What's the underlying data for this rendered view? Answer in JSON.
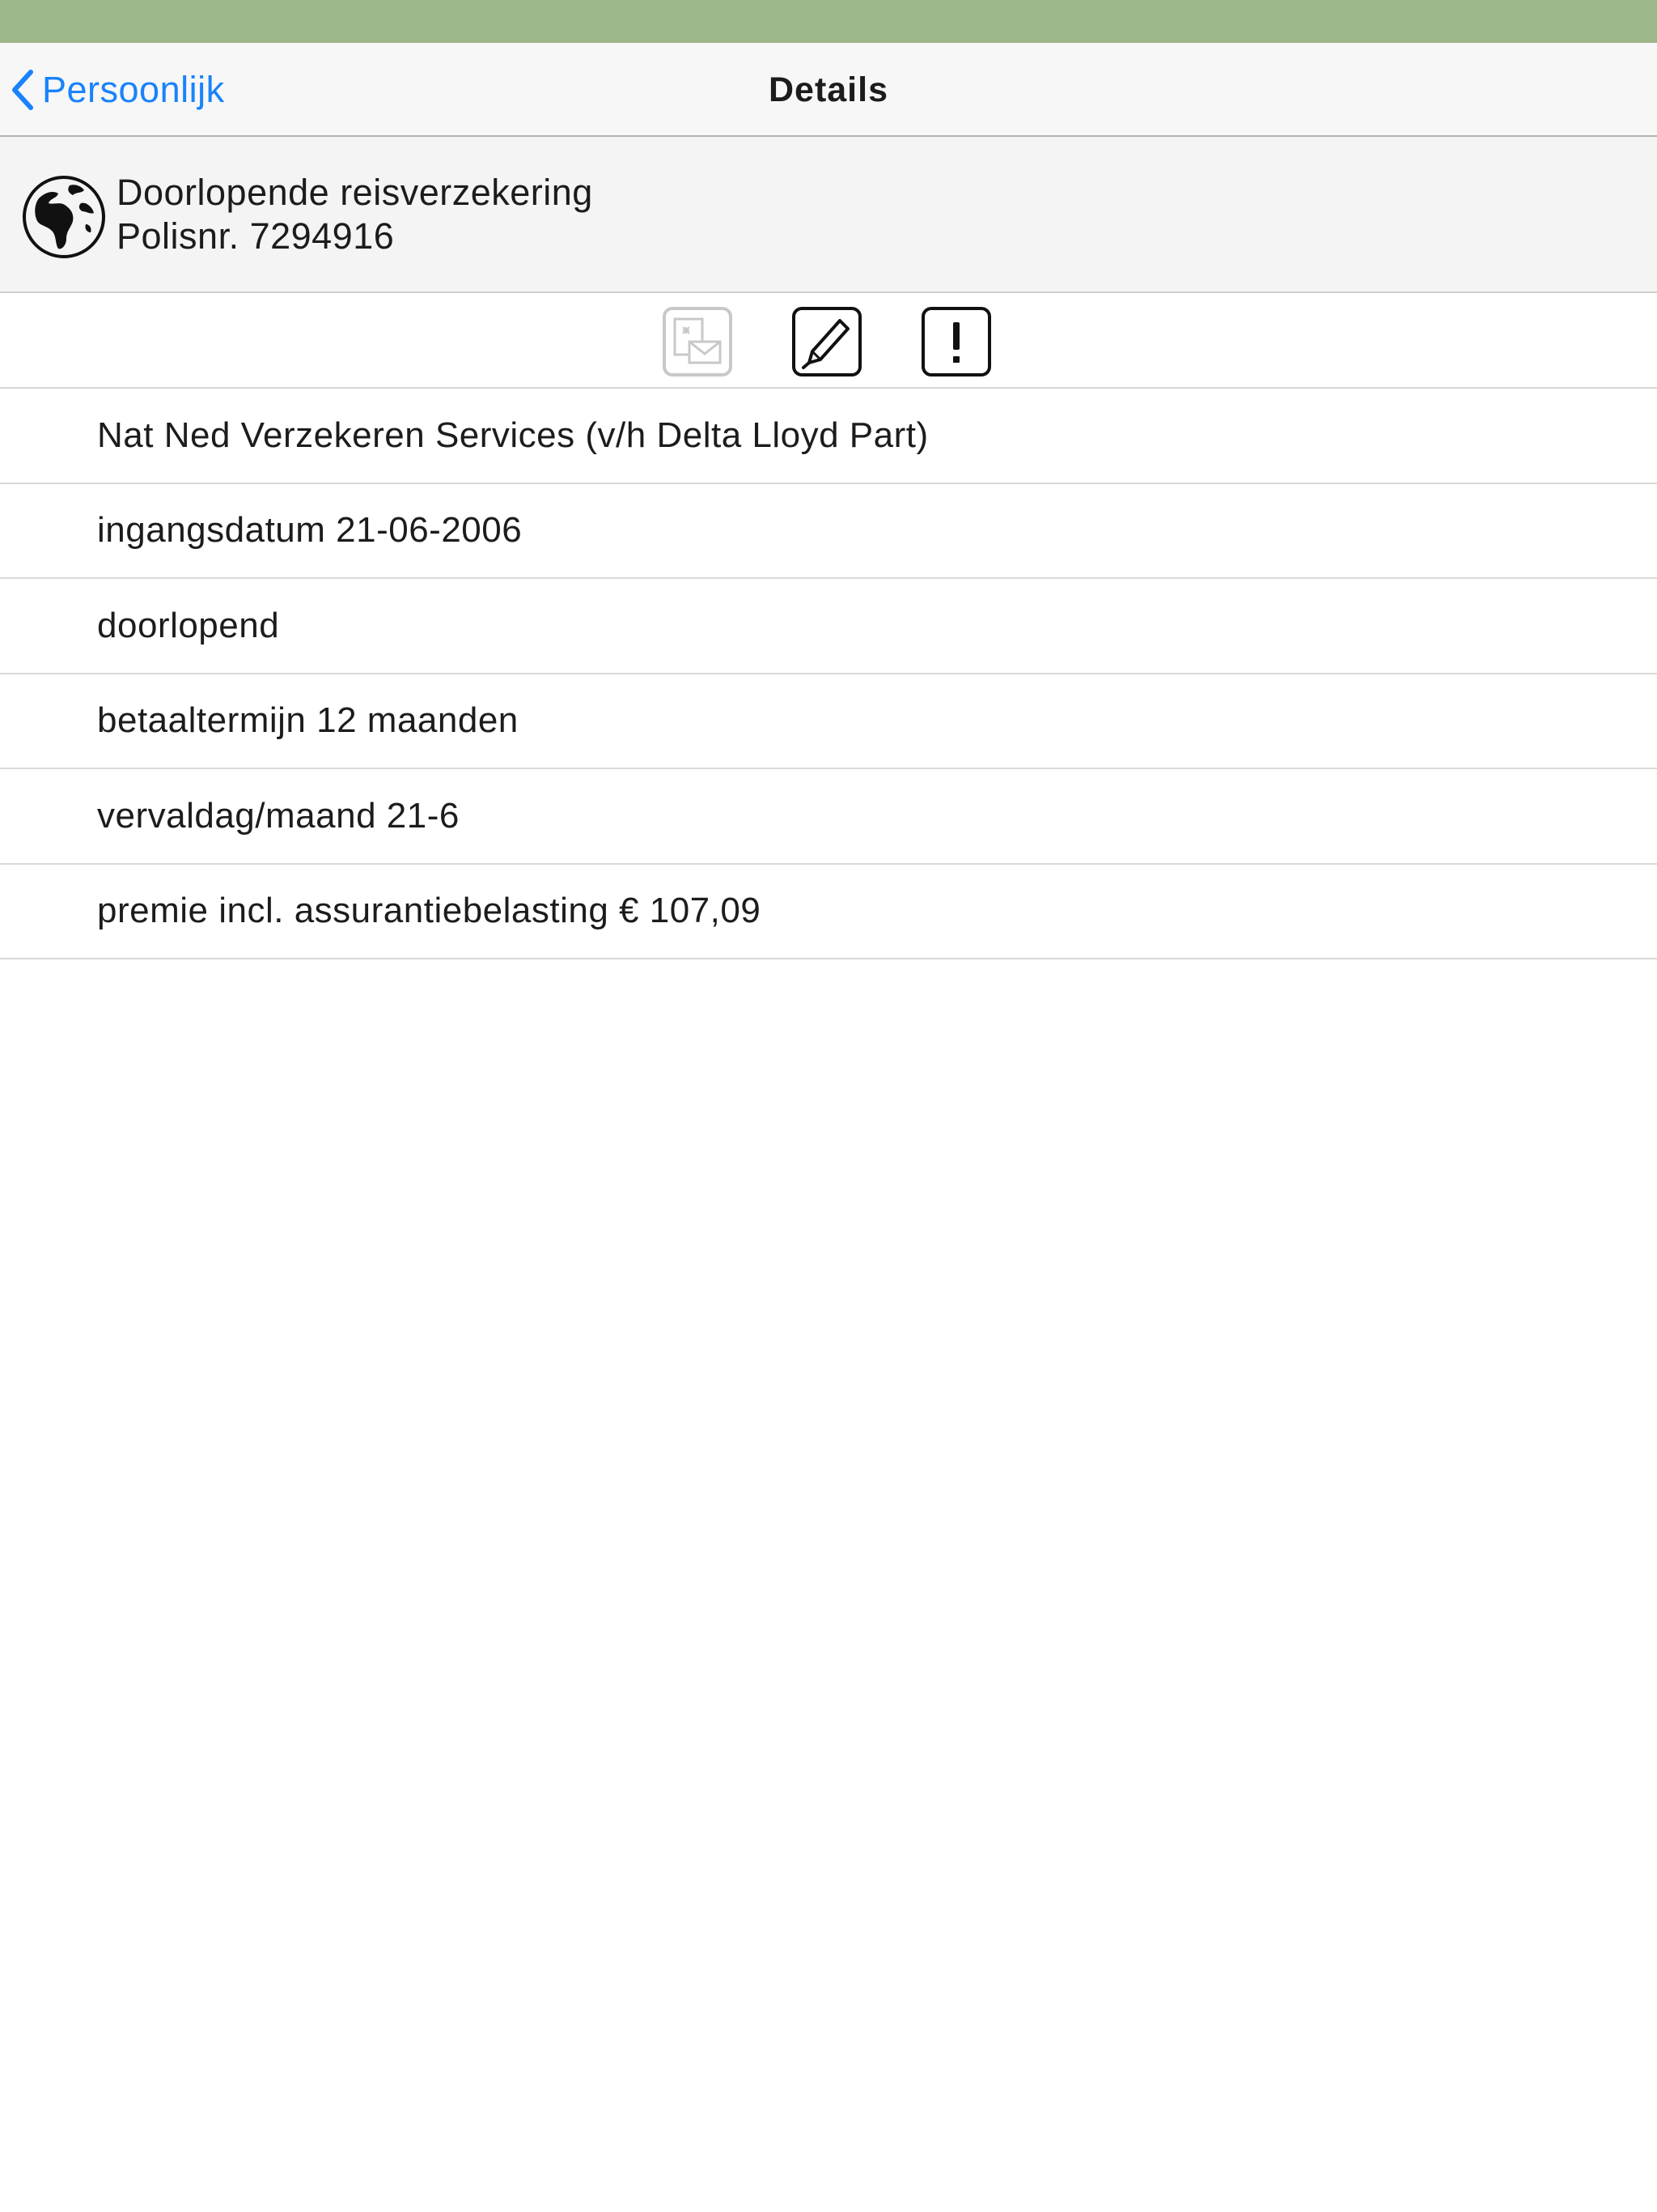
{
  "status_bar": {
    "color": "#9db68a"
  },
  "nav": {
    "back_label": "Persoonlijk",
    "back_icon": "chevron-left-icon",
    "title": "Details",
    "accent": "#1a82fb"
  },
  "policy": {
    "icon": "globe-icon",
    "name": "Doorlopende reisverzekering",
    "number": "Polisnr. 7294916"
  },
  "toolbar": {
    "buttons": [
      {
        "icon": "mail-document-icon",
        "enabled": false
      },
      {
        "icon": "edit-pencil-icon",
        "enabled": true
      },
      {
        "icon": "exclamation-icon",
        "enabled": true
      }
    ]
  },
  "details": [
    "Nat Ned Verzekeren Services (v/h Delta Lloyd Part)",
    "ingangsdatum 21-06-2006",
    "doorlopend",
    "betaaltermijn 12 maanden",
    "vervaldag/maand 21-6",
    "premie incl. assurantiebelasting € 107,09"
  ]
}
